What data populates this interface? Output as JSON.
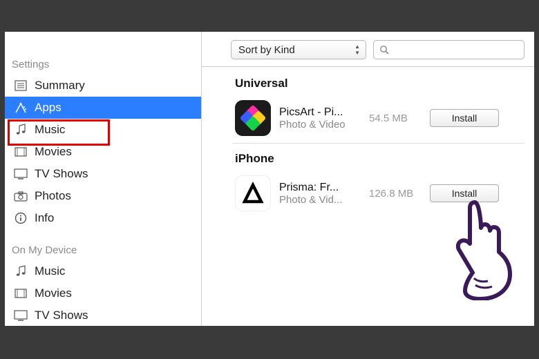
{
  "sidebar": {
    "group1_label": "Settings",
    "group1_items": [
      {
        "label": "Summary",
        "icon": "summary"
      },
      {
        "label": "Apps",
        "icon": "apps"
      },
      {
        "label": "Music",
        "icon": "music"
      },
      {
        "label": "Movies",
        "icon": "movies"
      },
      {
        "label": "TV Shows",
        "icon": "tv"
      },
      {
        "label": "Photos",
        "icon": "photos"
      },
      {
        "label": "Info",
        "icon": "info"
      }
    ],
    "group2_label": "On My Device",
    "group2_items": [
      {
        "label": "Music",
        "icon": "music"
      },
      {
        "label": "Movies",
        "icon": "movies"
      },
      {
        "label": "TV Shows",
        "icon": "tv"
      }
    ]
  },
  "toolbar": {
    "sort_label": "Sort by Kind",
    "search_placeholder": ""
  },
  "list": {
    "section1_header": "Universal",
    "section2_header": "iPhone",
    "apps": [
      {
        "name": "PicsArt - Pi...",
        "category": "Photo & Video",
        "size": "54.5 MB",
        "button": "Install"
      },
      {
        "name": "Prisma: Fr...",
        "category": "Photo & Vid...",
        "size": "126.8 MB",
        "button": "Install"
      }
    ]
  }
}
